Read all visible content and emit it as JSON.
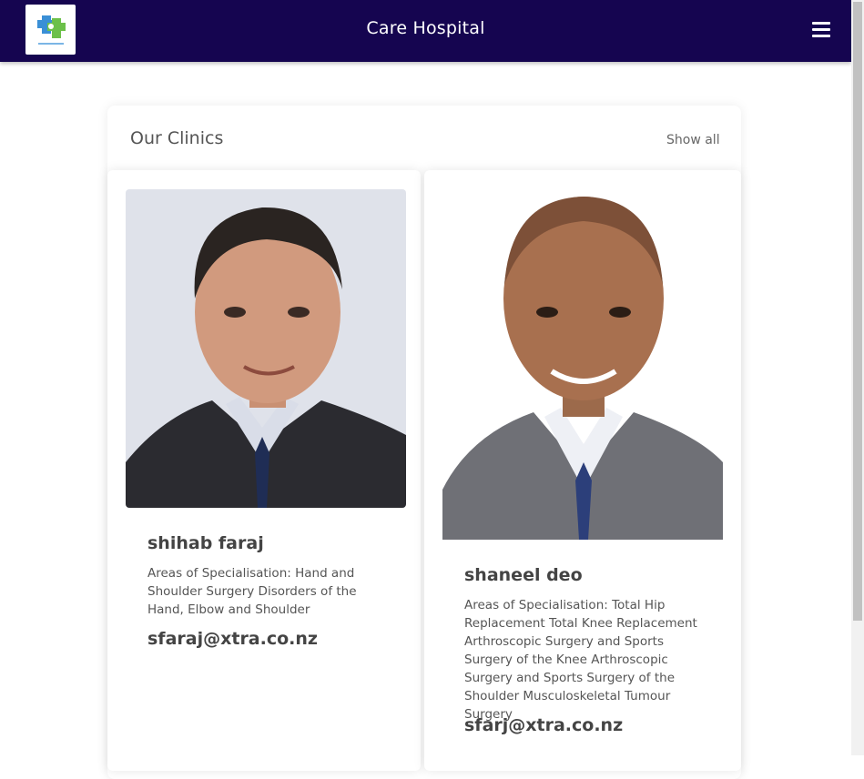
{
  "header": {
    "title": "Care Hospital",
    "logo_icon": "medical-cross-logo",
    "menu_icon": "hamburger-menu-icon",
    "background_color": "#150550"
  },
  "clinics": {
    "title": "Our Clinics",
    "show_all_label": "Show all",
    "doctors": [
      {
        "name": "shihab faraj",
        "specialisation": "Areas of Specialisation: Hand and Shoulder Surgery Disorders of the Hand, Elbow and Shoulder",
        "email": "sfaraj@xtra.co.nz"
      },
      {
        "name": "shaneel deo",
        "specialisation": "Areas of Specialisation: Total Hip Replacement Total Knee Replacement Arthroscopic Surgery and Sports Surgery of the Knee Arthroscopic Surgery and Sports Surgery of the Shoulder Musculoskeletal Tumour Surgery",
        "email": "sfarj@xtra.co.nz"
      }
    ]
  }
}
